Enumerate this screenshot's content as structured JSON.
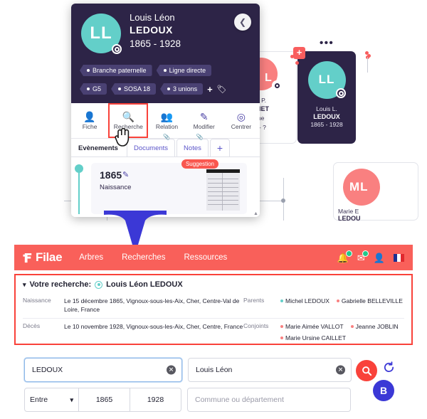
{
  "tree": {
    "dots_menu": "•••",
    "focus_card": {
      "avatar_initials": "LL",
      "given": "Louis L.",
      "surname": "LEDOUX",
      "years": "1865 - 1928",
      "avatar_color": "#63cfc9",
      "plus_badge": "+"
    },
    "left_card": {
      "given": "e P.",
      "surname": "NET",
      "line3": "ine",
      "line4": "’ - ?"
    },
    "bottom_card": {
      "avatar_initials": "ML",
      "given": "Marie E",
      "surname": "LEDOU",
      "avatar_color": "#f98080"
    }
  },
  "popup": {
    "avatar_initials": "LL",
    "given_name": "Louis Léon",
    "surname": "LEDOUX",
    "years": "1865 - 1928",
    "back_icon": "chevron-left",
    "tags": [
      "Branche paternelle",
      "Ligne directe",
      "G5",
      "SOSA 18",
      "3 unions"
    ],
    "add_tag": "+",
    "actions": [
      {
        "label": "Fiche",
        "icon": "id-card-icon",
        "selected": false
      },
      {
        "label": "Recherche",
        "icon": "search-icon",
        "selected": true
      },
      {
        "label": "Relation",
        "icon": "add-person-icon",
        "selected": false
      },
      {
        "label": "Modifier",
        "icon": "pencil-icon",
        "selected": false
      },
      {
        "label": "Centrer",
        "icon": "center-icon",
        "selected": false
      }
    ],
    "tabs": [
      {
        "label": "Evènements",
        "active": true,
        "clip": false
      },
      {
        "label": "Documents",
        "active": false,
        "clip": true
      },
      {
        "label": "Notes",
        "active": false,
        "clip": true
      },
      {
        "label": "+",
        "active": false,
        "clip": false
      }
    ],
    "event": {
      "year": "1865",
      "type": "Naissance",
      "badge": "Suggestion",
      "edit_icon": "pencil-icon"
    }
  },
  "filae": {
    "logo_text": "Filae",
    "nav": [
      "Arbres",
      "Recherches",
      "Ressources"
    ],
    "icons": [
      "bell-icon",
      "mail-icon",
      "user-icon",
      "flag-fr-icon"
    ],
    "result": {
      "title_prefix": "Votre recherche:",
      "person": "Louis Léon LEDOUX",
      "rows": [
        {
          "label": "Naissance",
          "value": "Le 15 décembre 1865, Vignoux-sous-les-Aix, Cher, Centre-Val de Loire, France",
          "right_label": "Parents",
          "right_items": [
            {
              "text": "Michel LEDOUX",
              "color": "#63cfc9"
            },
            {
              "text": "Gabrielle BELLEVILLE",
              "color": "#f98080"
            }
          ]
        },
        {
          "label": "Décès",
          "value": "Le 10 novembre 1928, Vignoux-sous-les-Aix, Cher, Centre, France",
          "right_label": "Conjoints",
          "right_items": [
            {
              "text": "Marie Aimée VALLOT",
              "color": "#f98080"
            },
            {
              "text": "Jeanne JOBLIN",
              "color": "#f98080"
            },
            {
              "text": "Marie Ursine CAILLET",
              "color": "#f98080"
            }
          ]
        }
      ]
    }
  },
  "form": {
    "surname_value": "LEDOUX",
    "given_value": "Louis Léon",
    "period_select": "Entre",
    "year_from": "1865",
    "year_to": "1928",
    "place_placeholder": "Commune ou département",
    "search_icon": "search-icon",
    "reset_icon": "reset-icon",
    "step_badge": "B"
  },
  "colors": {
    "brand_coral": "#f9605a",
    "accent_red": "#f9423a",
    "dark_purple": "#2d2447",
    "teal": "#63cfc9",
    "blue": "#3b38d6"
  }
}
